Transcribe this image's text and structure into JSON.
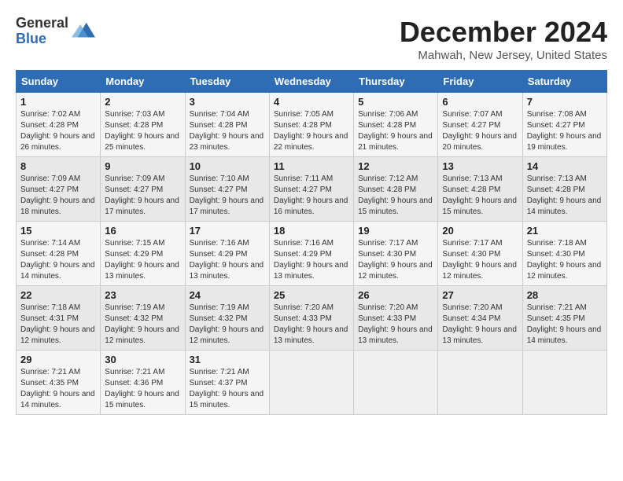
{
  "logo": {
    "general": "General",
    "blue": "Blue"
  },
  "title": "December 2024",
  "location": "Mahwah, New Jersey, United States",
  "days_of_week": [
    "Sunday",
    "Monday",
    "Tuesday",
    "Wednesday",
    "Thursday",
    "Friday",
    "Saturday"
  ],
  "weeks": [
    [
      {
        "day": "1",
        "sunrise": "7:02 AM",
        "sunset": "4:28 PM",
        "daylight": "9 hours and 26 minutes."
      },
      {
        "day": "2",
        "sunrise": "7:03 AM",
        "sunset": "4:28 PM",
        "daylight": "9 hours and 25 minutes."
      },
      {
        "day": "3",
        "sunrise": "7:04 AM",
        "sunset": "4:28 PM",
        "daylight": "9 hours and 23 minutes."
      },
      {
        "day": "4",
        "sunrise": "7:05 AM",
        "sunset": "4:28 PM",
        "daylight": "9 hours and 22 minutes."
      },
      {
        "day": "5",
        "sunrise": "7:06 AM",
        "sunset": "4:28 PM",
        "daylight": "9 hours and 21 minutes."
      },
      {
        "day": "6",
        "sunrise": "7:07 AM",
        "sunset": "4:27 PM",
        "daylight": "9 hours and 20 minutes."
      },
      {
        "day": "7",
        "sunrise": "7:08 AM",
        "sunset": "4:27 PM",
        "daylight": "9 hours and 19 minutes."
      }
    ],
    [
      {
        "day": "8",
        "sunrise": "7:09 AM",
        "sunset": "4:27 PM",
        "daylight": "9 hours and 18 minutes."
      },
      {
        "day": "9",
        "sunrise": "7:09 AM",
        "sunset": "4:27 PM",
        "daylight": "9 hours and 17 minutes."
      },
      {
        "day": "10",
        "sunrise": "7:10 AM",
        "sunset": "4:27 PM",
        "daylight": "9 hours and 17 minutes."
      },
      {
        "day": "11",
        "sunrise": "7:11 AM",
        "sunset": "4:27 PM",
        "daylight": "9 hours and 16 minutes."
      },
      {
        "day": "12",
        "sunrise": "7:12 AM",
        "sunset": "4:28 PM",
        "daylight": "9 hours and 15 minutes."
      },
      {
        "day": "13",
        "sunrise": "7:13 AM",
        "sunset": "4:28 PM",
        "daylight": "9 hours and 15 minutes."
      },
      {
        "day": "14",
        "sunrise": "7:13 AM",
        "sunset": "4:28 PM",
        "daylight": "9 hours and 14 minutes."
      }
    ],
    [
      {
        "day": "15",
        "sunrise": "7:14 AM",
        "sunset": "4:28 PM",
        "daylight": "9 hours and 14 minutes."
      },
      {
        "day": "16",
        "sunrise": "7:15 AM",
        "sunset": "4:29 PM",
        "daylight": "9 hours and 13 minutes."
      },
      {
        "day": "17",
        "sunrise": "7:16 AM",
        "sunset": "4:29 PM",
        "daylight": "9 hours and 13 minutes."
      },
      {
        "day": "18",
        "sunrise": "7:16 AM",
        "sunset": "4:29 PM",
        "daylight": "9 hours and 13 minutes."
      },
      {
        "day": "19",
        "sunrise": "7:17 AM",
        "sunset": "4:30 PM",
        "daylight": "9 hours and 12 minutes."
      },
      {
        "day": "20",
        "sunrise": "7:17 AM",
        "sunset": "4:30 PM",
        "daylight": "9 hours and 12 minutes."
      },
      {
        "day": "21",
        "sunrise": "7:18 AM",
        "sunset": "4:30 PM",
        "daylight": "9 hours and 12 minutes."
      }
    ],
    [
      {
        "day": "22",
        "sunrise": "7:18 AM",
        "sunset": "4:31 PM",
        "daylight": "9 hours and 12 minutes."
      },
      {
        "day": "23",
        "sunrise": "7:19 AM",
        "sunset": "4:32 PM",
        "daylight": "9 hours and 12 minutes."
      },
      {
        "day": "24",
        "sunrise": "7:19 AM",
        "sunset": "4:32 PM",
        "daylight": "9 hours and 12 minutes."
      },
      {
        "day": "25",
        "sunrise": "7:20 AM",
        "sunset": "4:33 PM",
        "daylight": "9 hours and 13 minutes."
      },
      {
        "day": "26",
        "sunrise": "7:20 AM",
        "sunset": "4:33 PM",
        "daylight": "9 hours and 13 minutes."
      },
      {
        "day": "27",
        "sunrise": "7:20 AM",
        "sunset": "4:34 PM",
        "daylight": "9 hours and 13 minutes."
      },
      {
        "day": "28",
        "sunrise": "7:21 AM",
        "sunset": "4:35 PM",
        "daylight": "9 hours and 14 minutes."
      }
    ],
    [
      {
        "day": "29",
        "sunrise": "7:21 AM",
        "sunset": "4:35 PM",
        "daylight": "9 hours and 14 minutes."
      },
      {
        "day": "30",
        "sunrise": "7:21 AM",
        "sunset": "4:36 PM",
        "daylight": "9 hours and 15 minutes."
      },
      {
        "day": "31",
        "sunrise": "7:21 AM",
        "sunset": "4:37 PM",
        "daylight": "9 hours and 15 minutes."
      },
      null,
      null,
      null,
      null
    ]
  ],
  "labels": {
    "sunrise": "Sunrise:",
    "sunset": "Sunset:",
    "daylight": "Daylight:"
  }
}
